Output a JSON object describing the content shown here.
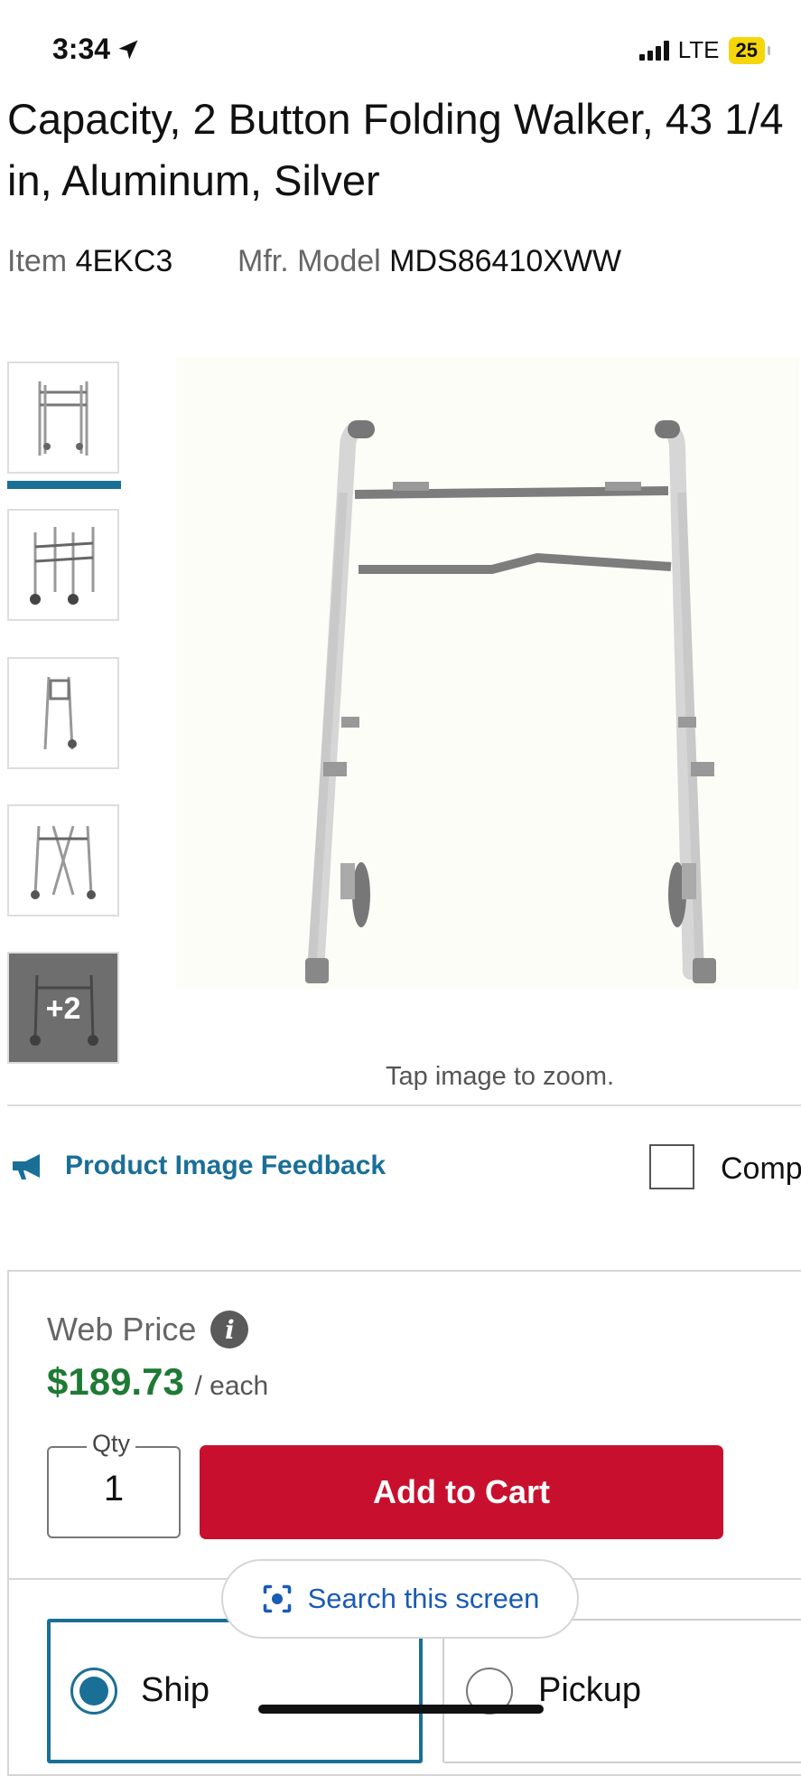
{
  "status_bar": {
    "time": "3:34",
    "network": "LTE",
    "battery": "25"
  },
  "product": {
    "title": "Capacity, 2 Button Folding Walker, 43 1/4 in, Aluminum, Silver",
    "item_label": "Item",
    "item_number": "4EKC3",
    "model_label": "Mfr. Model",
    "model_number": "MDS86410XWW"
  },
  "gallery": {
    "more_label": "+2",
    "zoom_hint": "Tap image to zoom.",
    "selected_index": 0
  },
  "feedback": {
    "label": "Product Image Feedback",
    "compare_label": "Comp"
  },
  "pricing": {
    "web_price_label": "Web Price",
    "price": "$189.73",
    "unit": "/ each",
    "qty_label": "Qty",
    "qty_value": "1",
    "add_to_cart": "Add to Cart"
  },
  "fulfillment": {
    "ship_label": "Ship",
    "pickup_label": "Pickup",
    "selected": "Ship"
  },
  "overlay": {
    "search_label": "Search this screen"
  },
  "colors": {
    "accent": "#1a6f97",
    "cart_red": "#c8102e",
    "price_green": "#1e7a34",
    "search_blue": "#1a5bb5"
  }
}
